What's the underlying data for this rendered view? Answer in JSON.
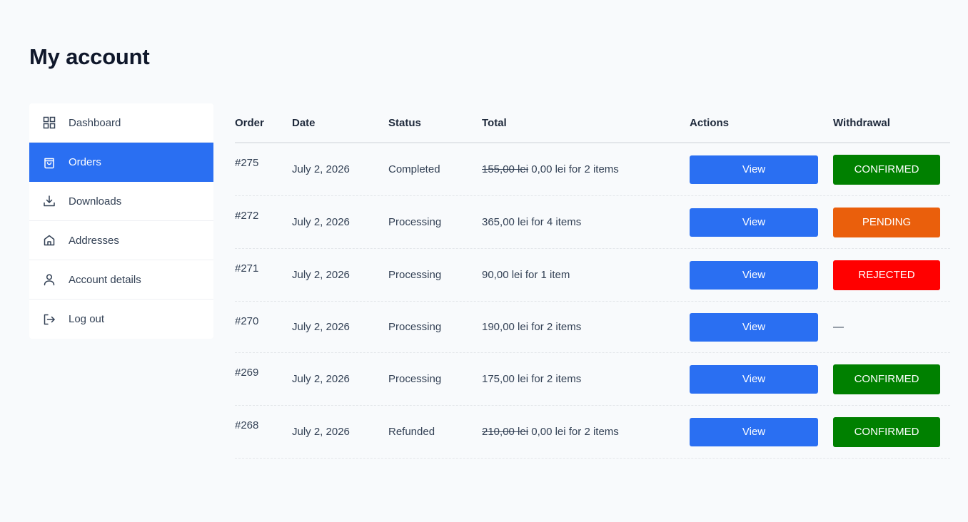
{
  "page": {
    "title": "My account"
  },
  "sidebar": {
    "items": [
      {
        "label": "Dashboard",
        "icon": "dashboard-grid-icon"
      },
      {
        "label": "Orders",
        "icon": "shopping-bag-icon",
        "active": true
      },
      {
        "label": "Downloads",
        "icon": "download-icon"
      },
      {
        "label": "Addresses",
        "icon": "home-icon"
      },
      {
        "label": "Account details",
        "icon": "user-icon"
      },
      {
        "label": "Log out",
        "icon": "logout-icon"
      }
    ]
  },
  "orders": {
    "headers": {
      "order": "Order",
      "date": "Date",
      "status": "Status",
      "total": "Total",
      "actions": "Actions",
      "withdrawal": "Withdrawal"
    },
    "view_label": "View",
    "rows": [
      {
        "number": "#275",
        "date": "July 2, 2026",
        "status": "Completed",
        "old_total": "155,00 lei",
        "total": " 0,00 lei for 2 items",
        "withdrawal": "CONFIRMED"
      },
      {
        "number": "#272",
        "date": "July 2, 2026",
        "status": "Processing",
        "old_total": "",
        "total": "365,00 lei for 4 items",
        "withdrawal": "PENDING"
      },
      {
        "number": "#271",
        "date": "July 2, 2026",
        "status": "Processing",
        "old_total": "",
        "total": "90,00 lei for 1 item",
        "withdrawal": "REJECTED"
      },
      {
        "number": "#270",
        "date": "July 2, 2026",
        "status": "Processing",
        "old_total": "",
        "total": "190,00 lei for 2 items",
        "withdrawal": "—"
      },
      {
        "number": "#269",
        "date": "July 2, 2026",
        "status": "Processing",
        "old_total": "",
        "total": "175,00 lei for 2 items",
        "withdrawal": "CONFIRMED"
      },
      {
        "number": "#268",
        "date": "July 2, 2026",
        "status": "Refunded",
        "old_total": "210,00 lei",
        "total": " 0,00 lei for 2 items",
        "withdrawal": "CONFIRMED"
      }
    ]
  },
  "colors": {
    "accent": "#2a6ff2",
    "confirmed": "#008000",
    "pending": "#ea5f0c",
    "rejected": "#ff0000"
  }
}
